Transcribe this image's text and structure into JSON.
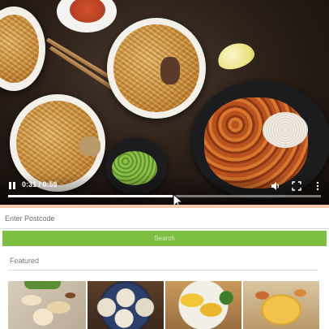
{
  "video": {
    "time_display": "0:31 / 0:59",
    "progress_fraction": 0.525,
    "icons": [
      "pause-icon",
      "volume-icon",
      "fullscreen-icon",
      "more-options-icon"
    ]
  },
  "form": {
    "postcode_placeholder": "Enter Postcode",
    "search_label": "Search"
  },
  "featured": {
    "title": "Featured",
    "items": [
      "thumbnail-1",
      "thumbnail-2",
      "thumbnail-3",
      "thumbnail-4"
    ]
  },
  "colors": {
    "search_button": "#7cbf43",
    "accent_divider": "#f4c9a8"
  }
}
